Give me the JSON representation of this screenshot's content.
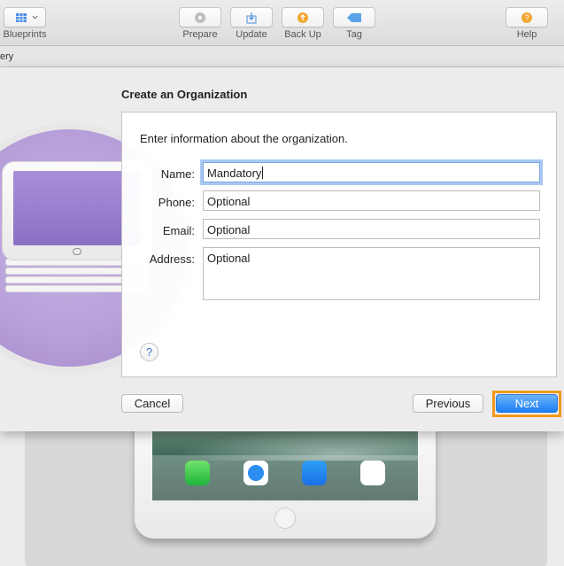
{
  "toolbar": {
    "blueprints_label": "Blueprints",
    "prepare_label": "Prepare",
    "update_label": "Update",
    "backup_label": "Back Up",
    "tag_label": "Tag",
    "help_label": "Help"
  },
  "pathbar": {
    "text": "ery"
  },
  "sheet": {
    "title": "Create an Organization",
    "intro": "Enter information about the organization.",
    "fields": [
      {
        "label": "Name:",
        "value": "Mandatory"
      },
      {
        "label": "Phone:",
        "placeholder": "Optional"
      },
      {
        "label": "Email:",
        "placeholder": "Optional"
      },
      {
        "label": "Address:",
        "placeholder": "Optional"
      }
    ],
    "help_symbol": "?",
    "cancel_label": "Cancel",
    "previous_label": "Previous",
    "next_label": "Next"
  },
  "icons": {
    "blueprints": "grid-icon",
    "prepare": "gear-icon",
    "update": "download-icon",
    "backup": "backup-icon",
    "tag": "tag-icon",
    "help": "help-icon"
  },
  "colors": {
    "accent": "#1b7ef6",
    "highlight": "#f39a1e",
    "hero_purple": "#b8a0da"
  }
}
